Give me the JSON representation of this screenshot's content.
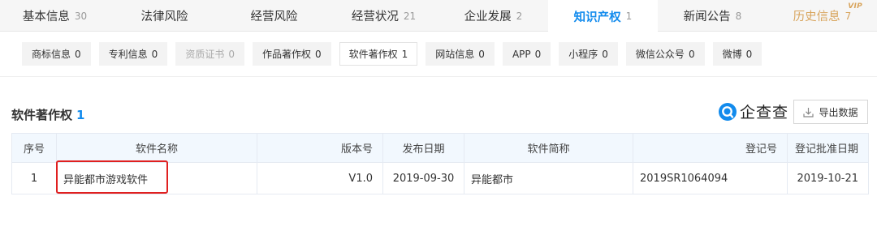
{
  "top_tabs": [
    {
      "label": "基本信息",
      "count": "30"
    },
    {
      "label": "法律风险",
      "count": ""
    },
    {
      "label": "经营风险",
      "count": ""
    },
    {
      "label": "经营状况",
      "count": "21"
    },
    {
      "label": "企业发展",
      "count": "2"
    },
    {
      "label": "知识产权",
      "count": "1"
    },
    {
      "label": "新闻公告",
      "count": "8"
    },
    {
      "label": "历史信息",
      "count": "7",
      "badge": "VIP"
    }
  ],
  "sub_tabs": [
    {
      "label": "商标信息",
      "count": "0"
    },
    {
      "label": "专利信息",
      "count": "0"
    },
    {
      "label": "资质证书",
      "count": "0"
    },
    {
      "label": "作品著作权",
      "count": "0"
    },
    {
      "label": "软件著作权",
      "count": "1"
    },
    {
      "label": "网站信息",
      "count": "0"
    },
    {
      "label": "APP",
      "count": "0"
    },
    {
      "label": "小程序",
      "count": "0"
    },
    {
      "label": "微信公众号",
      "count": "0"
    },
    {
      "label": "微博",
      "count": "0"
    }
  ],
  "section": {
    "title": "软件著作权",
    "count": "1"
  },
  "brand": {
    "name": "企查查"
  },
  "export": {
    "label": "导出数据"
  },
  "table": {
    "headers": [
      "序号",
      "软件名称",
      "版本号",
      "发布日期",
      "软件简称",
      "登记号",
      "登记批准日期"
    ],
    "rows": [
      [
        "1",
        "异能都市游戏软件",
        "V1.0",
        "2019-09-30",
        "异能都市",
        "2019SR1064094",
        "2019-10-21"
      ]
    ]
  },
  "colors": {
    "accent": "#128bed",
    "vip": "#d8a45c",
    "highlight": "#e02020",
    "header_bg": "#f2f8fe"
  },
  "icons": {
    "logo": "qichacha-logo-icon",
    "export": "download-icon"
  }
}
